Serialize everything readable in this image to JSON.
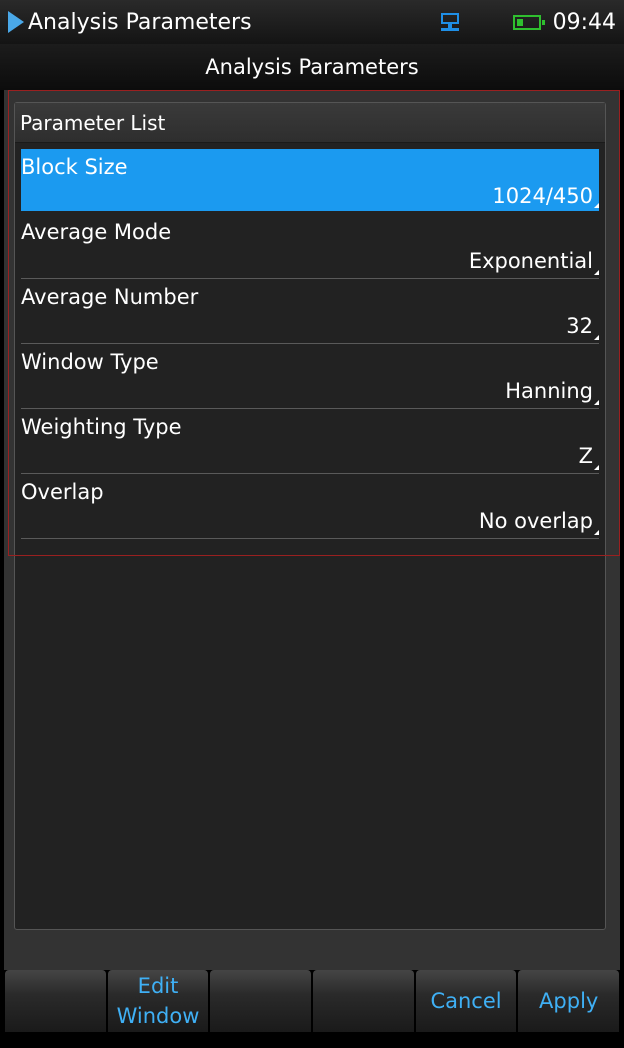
{
  "status_bar": {
    "title": "Analysis Parameters",
    "time": "09:44",
    "icons": [
      "play-arrow-icon",
      "network-icon",
      "battery-icon"
    ],
    "colors": {
      "network": "#1f8fe6",
      "battery": "#2fbf2f",
      "arrow": "#4aa8e8"
    }
  },
  "header": {
    "title": "Analysis Parameters"
  },
  "panel": {
    "title": "Parameter List",
    "selected_index": 0,
    "selected_color": "#1b9af0",
    "params": [
      {
        "label": "Block Size",
        "value": "1024/450"
      },
      {
        "label": "Average Mode",
        "value": "Exponential"
      },
      {
        "label": "Average Number",
        "value": "32"
      },
      {
        "label": "Window Type",
        "value": "Hanning"
      },
      {
        "label": "Weighting Type",
        "value": "Z"
      },
      {
        "label": "Overlap",
        "value": "No overlap"
      }
    ]
  },
  "softkeys": {
    "k1": "",
    "k2_line1": "Edit",
    "k2_line2": "Window",
    "k3": "",
    "k4": "",
    "k5": "Cancel",
    "k6": "Apply",
    "text_color": "#3fb0f5"
  }
}
